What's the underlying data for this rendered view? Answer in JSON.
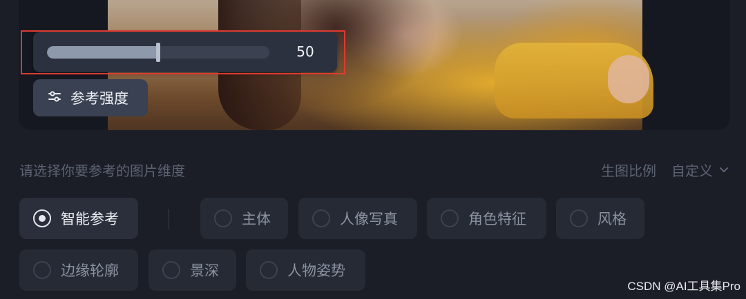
{
  "slider": {
    "value": "50",
    "fraction": 0.5
  },
  "strength_button": {
    "label": "参考强度",
    "icon": "sliders-icon"
  },
  "prompt": "请选择你要参考的图片维度",
  "ratio": {
    "label": "生图比例",
    "value": "自定义",
    "icon": "chevron-down-icon"
  },
  "dimensions": [
    {
      "label": "智能参考",
      "selected": true
    },
    {
      "label": "主体",
      "selected": false
    },
    {
      "label": "人像写真",
      "selected": false
    },
    {
      "label": "角色特征",
      "selected": false
    },
    {
      "label": "风格",
      "selected": false
    },
    {
      "label": "边缘轮廓",
      "selected": false
    },
    {
      "label": "景深",
      "selected": false
    },
    {
      "label": "人物姿势",
      "selected": false
    }
  ],
  "watermark": "CSDN @AI工具集Pro",
  "colors": {
    "highlight": "#e03a30",
    "background": "#1b1e27",
    "chip": "#252a35"
  }
}
